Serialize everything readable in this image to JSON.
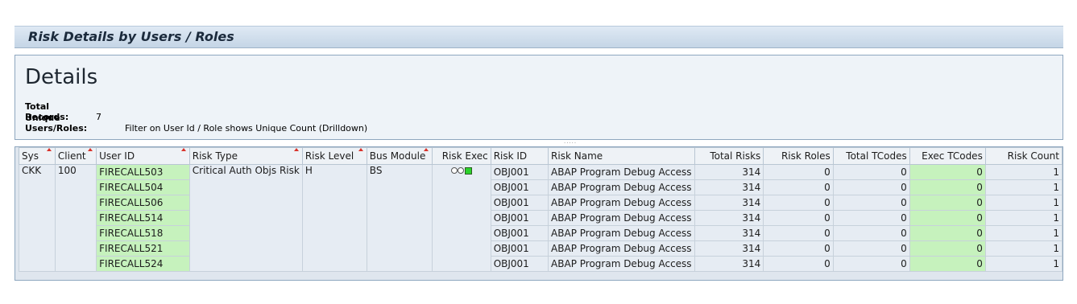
{
  "title": "Risk Details by Users / Roles",
  "details": {
    "heading": "Details",
    "total_records_label": "Total Records:",
    "total_records_value": "7",
    "unique_label": "Unique Users/Roles:",
    "unique_value": "Filter on User Id / Role shows Unique Count (Drilldown)"
  },
  "table": {
    "headers": [
      "Sys",
      "Client",
      "User ID",
      "Risk Type",
      "Risk Level",
      "Bus Module",
      "Risk Exec",
      "Risk ID",
      "Risk Name",
      "Total Risks",
      "Risk Roles",
      "Total TCodes",
      "Exec TCodes",
      "Risk Count"
    ],
    "group": {
      "sys": "CKK",
      "client": "100",
      "risk_type": "Critical Auth Objs Risk",
      "risk_level": "H",
      "bus_module": "BS"
    },
    "rows": [
      {
        "user_id": "FIRECALL503",
        "risk_id": "OBJ001",
        "risk_name": "ABAP Program Debug Access",
        "total_risks": "314",
        "risk_roles": "0",
        "total_tcodes": "0",
        "exec_tcodes": "0",
        "risk_count": "1"
      },
      {
        "user_id": "FIRECALL504",
        "risk_id": "OBJ001",
        "risk_name": "ABAP Program Debug Access",
        "total_risks": "314",
        "risk_roles": "0",
        "total_tcodes": "0",
        "exec_tcodes": "0",
        "risk_count": "1"
      },
      {
        "user_id": "FIRECALL506",
        "risk_id": "OBJ001",
        "risk_name": "ABAP Program Debug Access",
        "total_risks": "314",
        "risk_roles": "0",
        "total_tcodes": "0",
        "exec_tcodes": "0",
        "risk_count": "1"
      },
      {
        "user_id": "FIRECALL514",
        "risk_id": "OBJ001",
        "risk_name": "ABAP Program Debug Access",
        "total_risks": "314",
        "risk_roles": "0",
        "total_tcodes": "0",
        "exec_tcodes": "0",
        "risk_count": "1"
      },
      {
        "user_id": "FIRECALL518",
        "risk_id": "OBJ001",
        "risk_name": "ABAP Program Debug Access",
        "total_risks": "314",
        "risk_roles": "0",
        "total_tcodes": "0",
        "exec_tcodes": "0",
        "risk_count": "1"
      },
      {
        "user_id": "FIRECALL521",
        "risk_id": "OBJ001",
        "risk_name": "ABAP Program Debug Access",
        "total_risks": "314",
        "risk_roles": "0",
        "total_tcodes": "0",
        "exec_tcodes": "0",
        "risk_count": "1"
      },
      {
        "user_id": "FIRECALL524",
        "risk_id": "OBJ001",
        "risk_name": "ABAP Program Debug Access",
        "total_risks": "314",
        "risk_roles": "0",
        "total_tcodes": "0",
        "exec_tcodes": "0",
        "risk_count": "1"
      }
    ]
  },
  "colors": {
    "green_cell": "#c6f2bd",
    "sort_marker": "#d8322a",
    "title_bg": "#c5d5e6"
  },
  "icons": {
    "risk_exec": "traffic-light-green-icon",
    "sort": "sort-ascending-icon"
  }
}
